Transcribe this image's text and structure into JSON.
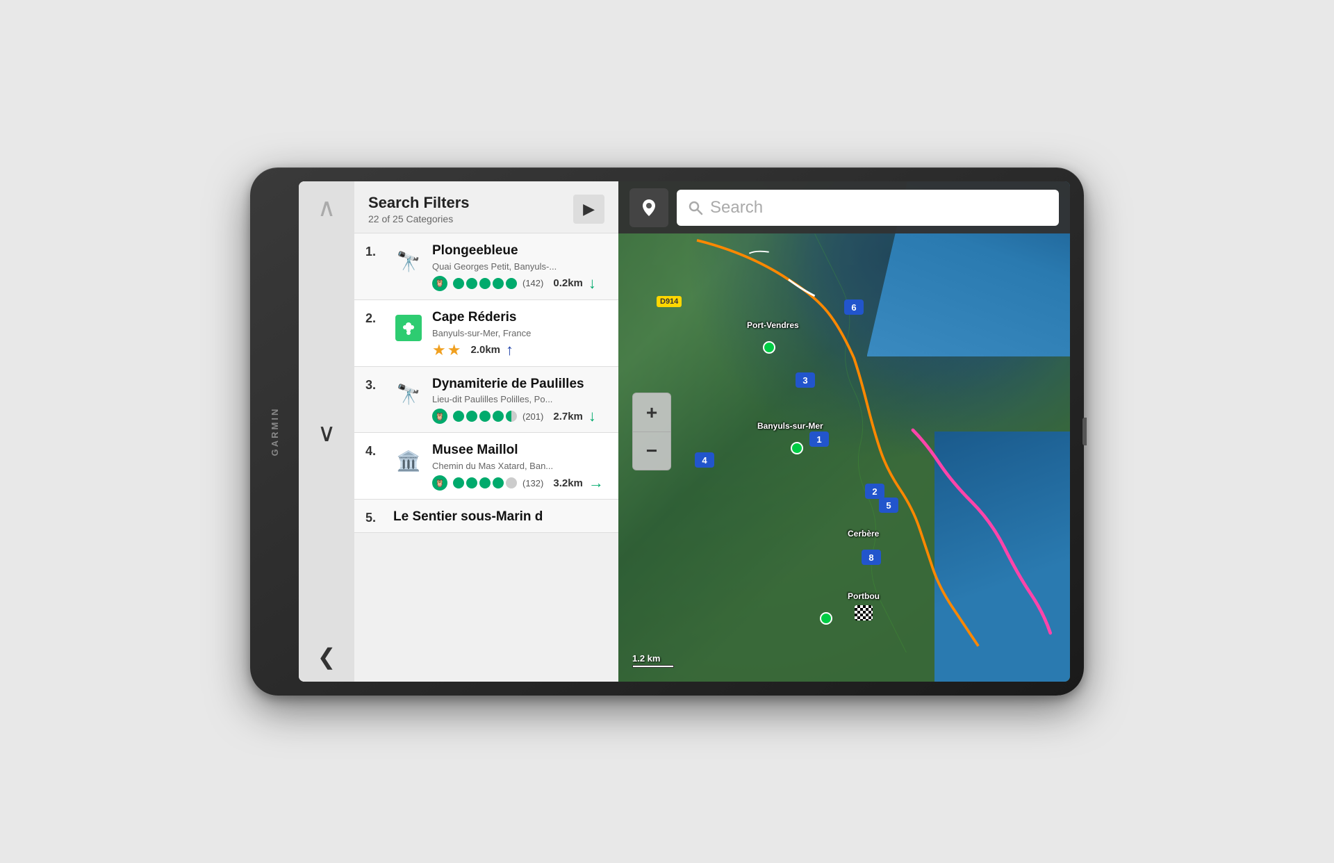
{
  "device": {
    "brand": "GARMIN"
  },
  "header": {
    "title": "Search Filters",
    "subtitle": "22 of 25 Categories"
  },
  "search": {
    "placeholder": "Search"
  },
  "poi_list": [
    {
      "number": "1.",
      "name": "Plongeebleue",
      "address": "Quai Georges Petit, Banyuls-...",
      "icon_type": "binoculars",
      "rating_type": "tripadvisor_dots",
      "dots": 5,
      "half_dot": false,
      "review_count": "(142)",
      "distance": "0.2km",
      "arrow_dir": "down",
      "arrow_color": "green"
    },
    {
      "number": "2.",
      "name": "Cape Réderis",
      "address": "Banyuls-sur-Mer, France",
      "icon_type": "michelin",
      "rating_type": "stars",
      "star_count": 2,
      "review_count": "",
      "distance": "2.0km",
      "arrow_dir": "up",
      "arrow_color": "blue"
    },
    {
      "number": "3.",
      "name": "Dynamiterie de Paulilles",
      "address": "Lieu-dit Paulilles Polilles, Po...",
      "icon_type": "binoculars",
      "rating_type": "tripadvisor_dots",
      "dots": 4,
      "half_dot": true,
      "review_count": "(201)",
      "distance": "2.7km",
      "arrow_dir": "down",
      "arrow_color": "green"
    },
    {
      "number": "4.",
      "name": "Musee Maillol",
      "address": "Chemin du Mas Xatard, Ban...",
      "icon_type": "museum",
      "rating_type": "tripadvisor_dots",
      "dots": 4,
      "half_dot": false,
      "review_count": "(132)",
      "distance": "3.2km",
      "arrow_dir": "right",
      "arrow_color": "green"
    },
    {
      "number": "5.",
      "name": "Le Sentier sous-Marin d",
      "address": "",
      "icon_type": "none",
      "rating_type": "none",
      "review_count": "",
      "distance": "",
      "arrow_dir": "none",
      "arrow_color": ""
    }
  ],
  "map": {
    "scale_label": "1.2 km",
    "city_labels": [
      "Port-Vendres",
      "Banyuls-sur-Mer",
      "Cerbère",
      "Portbou"
    ],
    "road_sign": "D914",
    "pins": [
      "1",
      "2",
      "3",
      "4",
      "5",
      "6",
      "8"
    ]
  },
  "zoom": {
    "plus_label": "+",
    "minus_label": "−"
  },
  "nav": {
    "up_arrow": "∧",
    "down_arrow": "∨",
    "left_arrow": "<"
  }
}
